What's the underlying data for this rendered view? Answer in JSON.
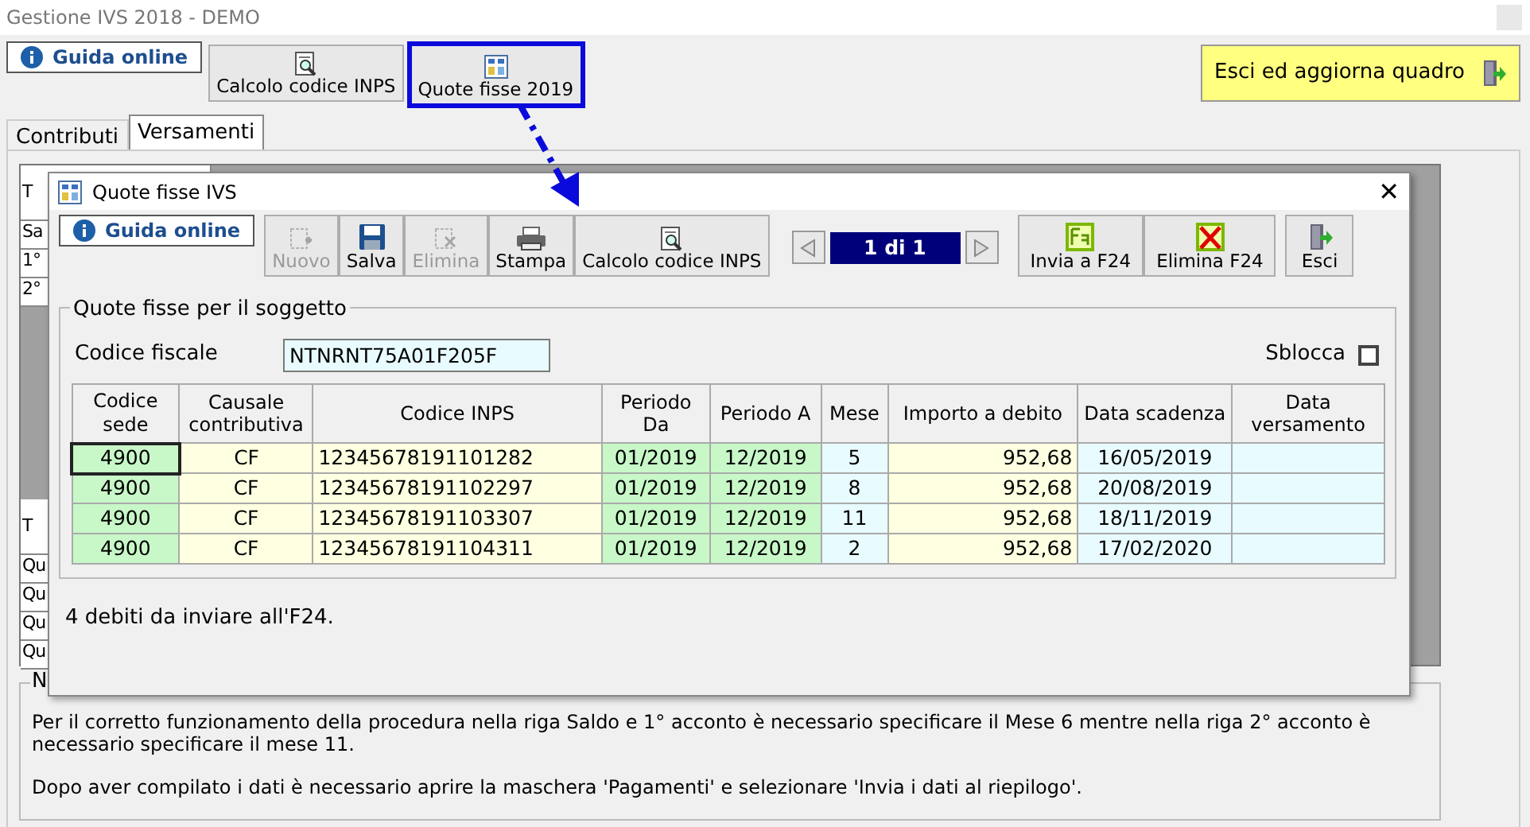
{
  "window": {
    "title": "Gestione IVS 2018 - DEMO"
  },
  "toolbar": {
    "help": "Guida online",
    "buttons": [
      {
        "label": "Calcolo codice INPS",
        "highlighted": false
      },
      {
        "label": "Quote fisse 2019",
        "highlighted": true
      }
    ],
    "exit": "Esci ed aggiorna quadro"
  },
  "tabs": [
    {
      "label": "Contributi",
      "selected": false
    },
    {
      "label": "Versamenti",
      "selected": true
    }
  ],
  "background_table": {
    "top_rows": [
      "T",
      "Sa",
      "1°",
      "2°"
    ],
    "bottom_rows": [
      "T",
      "Qu",
      "Qu",
      "Qu",
      "Qu"
    ]
  },
  "notes": {
    "title": "N",
    "paragraphs": [
      "Per il corretto funzionamento della procedura nella riga Saldo e 1° acconto è necessario specificare il Mese 6 mentre nella riga 2° acconto è necessario specificare il mese 11.",
      "Dopo aver compilato i dati è necessario aprire la maschera 'Pagamenti' e selezionare 'Invia i dati al riepilogo'."
    ]
  },
  "dialog": {
    "title": "Quote fisse IVS",
    "close": "✕",
    "help": "Guida online",
    "buttons": [
      {
        "label": "Nuovo",
        "disabled": true
      },
      {
        "label": "Salva",
        "disabled": false
      },
      {
        "label": "Elimina",
        "disabled": true
      },
      {
        "label": "Stampa",
        "disabled": false
      },
      {
        "label": "Calcolo codice INPS",
        "disabled": false
      }
    ],
    "pager": "1 di 1",
    "f24_buttons": [
      {
        "label": "Invia a F24"
      },
      {
        "label": "Elimina F24"
      }
    ],
    "exit": "Esci",
    "group": {
      "title": "Quote fisse per il soggetto",
      "fiscal_code_label": "Codice fiscale",
      "fiscal_code": "NTNRNT75A01F205F",
      "unlock_label": "Sblocca",
      "unlock_checked": false,
      "table": {
        "columns": [
          {
            "label": "Codice sede",
            "color": "#c8f7c8"
          },
          {
            "label": "Causale contributiva",
            "color": "#ffffe1"
          },
          {
            "label": "Codice INPS",
            "color": "#ffffe1"
          },
          {
            "label": "Periodo Da",
            "color": "#c8f7c8"
          },
          {
            "label": "Periodo A",
            "color": "#c8f7c8"
          },
          {
            "label": "Mese",
            "color": "#e8fbff"
          },
          {
            "label": "Importo a debito",
            "color": "#ffffe1"
          },
          {
            "label": "Data scadenza",
            "color": "#e8fbff"
          },
          {
            "label": "Data versamento",
            "color": "#e8fbff"
          }
        ],
        "rows": [
          {
            "selected": true,
            "cells": [
              "4900",
              "CF",
              "12345678191101282",
              "01/2019",
              "12/2019",
              "5",
              "952,68",
              "16/05/2019",
              ""
            ]
          },
          {
            "selected": false,
            "cells": [
              "4900",
              "CF",
              "12345678191102297",
              "01/2019",
              "12/2019",
              "8",
              "952,68",
              "20/08/2019",
              ""
            ]
          },
          {
            "selected": false,
            "cells": [
              "4900",
              "CF",
              "12345678191103307",
              "01/2019",
              "12/2019",
              "11",
              "952,68",
              "18/11/2019",
              ""
            ]
          },
          {
            "selected": false,
            "cells": [
              "4900",
              "CF",
              "12345678191104311",
              "01/2019",
              "12/2019",
              "2",
              "952,68",
              "17/02/2020",
              ""
            ]
          }
        ]
      }
    },
    "footer": "4 debiti da inviare all'F24."
  }
}
